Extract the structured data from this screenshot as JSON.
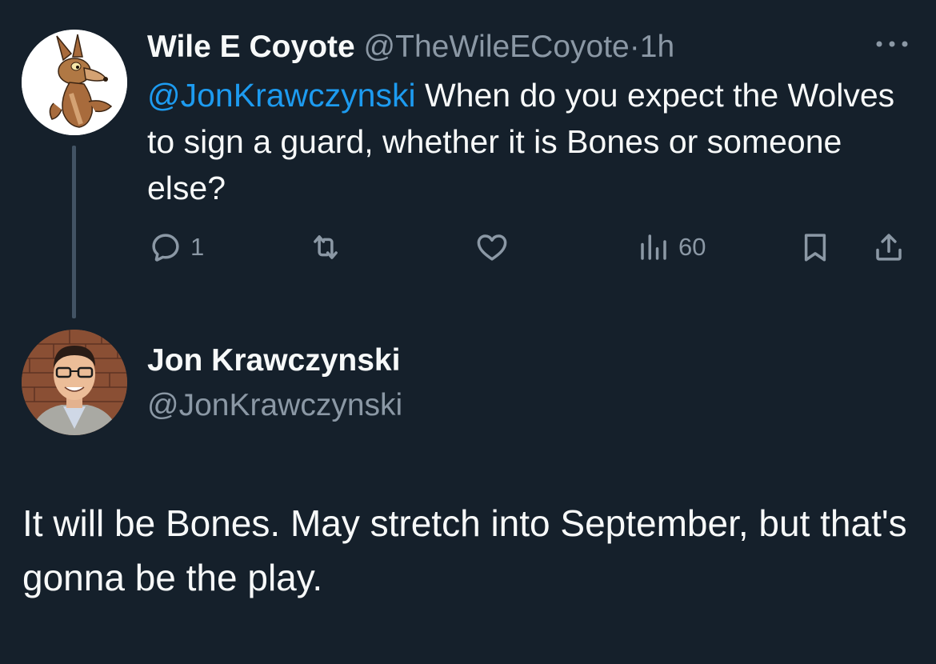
{
  "tweet": {
    "author_name": "Wile E Coyote",
    "author_handle": "@TheWileECoyote",
    "separator": "·",
    "time": "1h",
    "mention": "@JonKrawczynski",
    "text": " When do you expect the Wolves to sign a guard, whether it is Bones or someone else?",
    "avatar_icon": "cartoon-coyote-avatar",
    "actions": {
      "reply_count": "1",
      "retweet_count": "",
      "like_count": "",
      "views_count": "60"
    }
  },
  "reply": {
    "author_name": "Jon Krawczynski",
    "author_handle": "@JonKrawczynski",
    "text": "It will be Bones. May stretch into September, but that's gonna be the play.",
    "avatar_icon": "person-photo-avatar"
  },
  "colors": {
    "background": "#15202b",
    "primary_text": "#f7f9f9",
    "secondary_text": "#8b98a5",
    "link": "#1d9bf0",
    "thread_line": "#425364"
  },
  "icons": {
    "more": "more-options-icon",
    "reply": "reply-icon",
    "retweet": "retweet-icon",
    "like": "heart-icon",
    "views": "views-icon",
    "bookmark": "bookmark-icon",
    "share": "share-icon"
  }
}
